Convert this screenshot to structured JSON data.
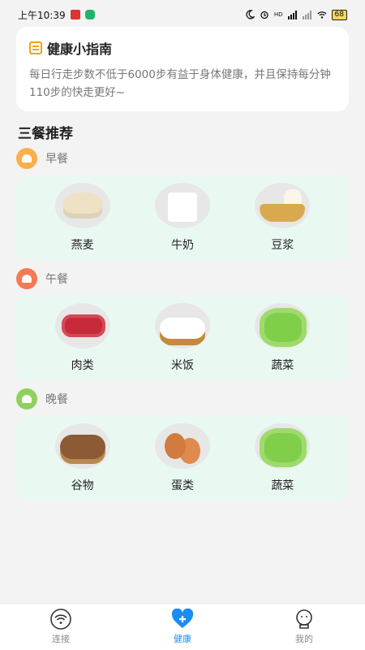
{
  "status_bar": {
    "time": "上午10:39",
    "battery": "68",
    "hd_label": "HD"
  },
  "tip": {
    "title": "健康小指南",
    "text": "每日行走步数不低于6000步有益于身体健康，并且保持每分钟110步的快走更好~",
    "accent_color": "#f3a11b"
  },
  "section": {
    "title": "三餐推荐"
  },
  "meals": [
    {
      "label": "早餐",
      "badge_color": "#f9b04a",
      "foods": [
        {
          "name": "燕麦",
          "icon": "oats-image"
        },
        {
          "name": "牛奶",
          "icon": "milk-image"
        },
        {
          "name": "豆浆",
          "icon": "soy-milk-image"
        }
      ]
    },
    {
      "label": "午餐",
      "badge_color": "#f27a55",
      "foods": [
        {
          "name": "肉类",
          "icon": "meat-image"
        },
        {
          "name": "米饭",
          "icon": "rice-image"
        },
        {
          "name": "蔬菜",
          "icon": "vegetable-image"
        }
      ]
    },
    {
      "label": "晚餐",
      "badge_color": "#8fd15c",
      "foods": [
        {
          "name": "谷物",
          "icon": "grain-image"
        },
        {
          "name": "蛋类",
          "icon": "egg-image"
        },
        {
          "name": "蔬菜",
          "icon": "vegetable-image"
        }
      ]
    }
  ],
  "nav": [
    {
      "label": "连接",
      "icon": "wifi-icon",
      "active": false
    },
    {
      "label": "健康",
      "icon": "heart-plus-icon",
      "active": true
    },
    {
      "label": "我的",
      "icon": "profile-icon",
      "active": false
    }
  ],
  "colors": {
    "active": "#1a8df2",
    "card_bg": "#eaf8f2"
  }
}
